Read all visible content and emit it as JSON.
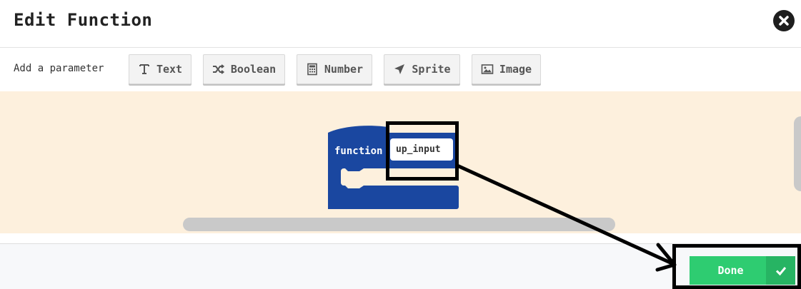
{
  "dialog": {
    "title": "Edit Function"
  },
  "parameters": {
    "label": "Add a parameter",
    "buttons": [
      {
        "label": "Text",
        "icon": "text-type-icon"
      },
      {
        "label": "Boolean",
        "icon": "shuffle-icon"
      },
      {
        "label": "Number",
        "icon": "calculator-icon"
      },
      {
        "label": "Sprite",
        "icon": "paper-plane-icon"
      },
      {
        "label": "Image",
        "icon": "image-icon"
      }
    ]
  },
  "block": {
    "keyword": "function",
    "name_value": "up_input"
  },
  "footer": {
    "done_label": "Done"
  },
  "colors": {
    "workspace_bg": "#fdf0dd",
    "block_blue": "#1a47a0",
    "done_green": "#2ecc71"
  }
}
